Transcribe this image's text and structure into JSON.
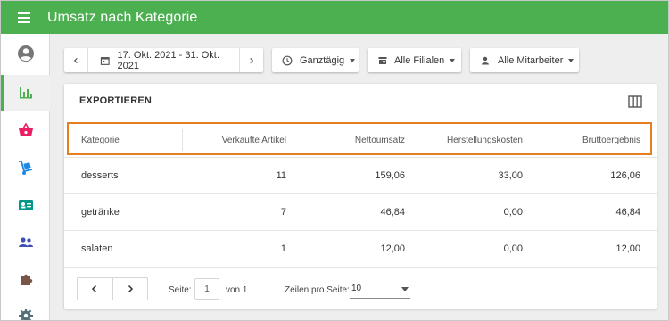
{
  "app": {
    "title": "Umsatz nach Kategorie"
  },
  "sidebar": {
    "items": [
      {
        "name": "account",
        "icon": "account-circle-icon",
        "active": false
      },
      {
        "name": "reports",
        "icon": "bar-chart-icon",
        "active": true
      },
      {
        "name": "sales",
        "icon": "basket-icon",
        "active": false
      },
      {
        "name": "delivery",
        "icon": "hand-truck-icon",
        "active": false
      },
      {
        "name": "contacts",
        "icon": "contact-card-icon",
        "active": false
      },
      {
        "name": "staff",
        "icon": "people-icon",
        "active": false
      },
      {
        "name": "extensions",
        "icon": "puzzle-icon",
        "active": false
      },
      {
        "name": "settings",
        "icon": "gear-icon",
        "active": false
      }
    ]
  },
  "toolbar": {
    "date_range": "17. Okt. 2021 - 31. Okt. 2021",
    "time_filter": "Ganztägig",
    "branch_filter": "Alle Filialen",
    "staff_filter": "Alle Mitarbeiter"
  },
  "card": {
    "export_label": "EXPORTIEREN"
  },
  "table": {
    "columns": [
      "Kategorie",
      "Verkaufte Artikel",
      "Nettoumsatz",
      "Herstellungskosten",
      "Bruttoergebnis"
    ],
    "rows": [
      [
        "desserts",
        "11",
        "159,06",
        "33,00",
        "126,06"
      ],
      [
        "getränke",
        "7",
        "46,84",
        "0,00",
        "46,84"
      ],
      [
        "salaten",
        "1",
        "12,00",
        "0,00",
        "12,00"
      ]
    ]
  },
  "pagination": {
    "page_label": "Seite:",
    "page_value": "1",
    "of_label": "von 1",
    "rows_label": "Zeilen pro Seite:",
    "rows_value": "10"
  },
  "colors": {
    "brand": "#4caf50",
    "highlight": "#e67e22"
  }
}
